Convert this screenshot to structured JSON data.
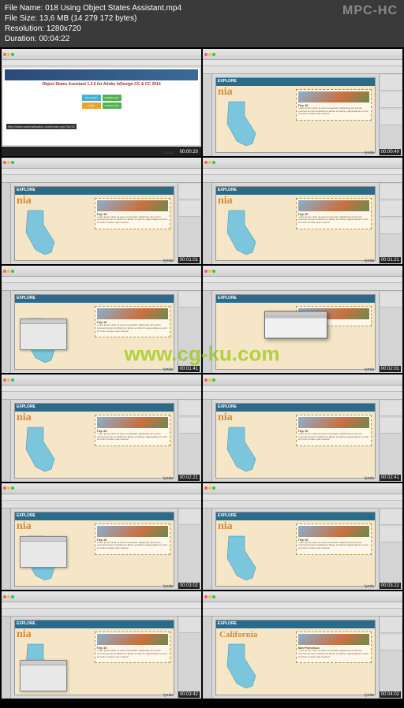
{
  "player": {
    "app_name": "MPC-HC",
    "file_name_label": "File Name:",
    "file_name": "018 Using Object States Assistant.mp4",
    "file_size_label": "File Size:",
    "file_size": "13,6 MB (14 279 172 bytes)",
    "resolution_label": "Resolution:",
    "resolution": "1280x720",
    "duration_label": "Duration:",
    "duration": "00:04:22"
  },
  "browser": {
    "headline": "Object States Assistant 1.2.0 for Adobe InDesign CC & CC 2014",
    "buy_label": "BUY NOW",
    "download_label": "DOWNLOAD",
    "cart_label": "CART",
    "url_hint": "http://www.automatication.com/index.php?id=22"
  },
  "doc": {
    "explore_label": "EXPLORE",
    "title_full": "California",
    "title_partial": "nia",
    "sidebar_title": "San Francisco",
    "trip_label": "Trip 10",
    "lorem": "Lorem ipsum dolor sit amet consectetur adipiscing elit sed do eiusmod tempor incididunt ut labore et dolore magna aliqua ut enim ad minim veniam quis nostrud"
  },
  "watermark": "www.cg-ku.com",
  "lynda": "lynda",
  "timestamps": [
    "00:00:20",
    "00:00:40",
    "00:01:01",
    "00:01:21",
    "00:01:41",
    "00:02:01",
    "00:02:21",
    "00:02:41",
    "00:03:02",
    "00:03:22",
    "00:03:42",
    "00:04:02"
  ]
}
